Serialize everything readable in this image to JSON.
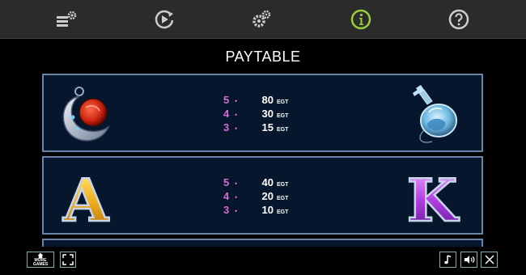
{
  "toolbar": {
    "icons": [
      "paytable-settings-icon",
      "autoplay-icon",
      "settings-icon",
      "info-icon",
      "help-icon"
    ],
    "active_color": "#9ccc3c",
    "icon_color": "#cccccc"
  },
  "title": "PAYTABLE",
  "rows": [
    {
      "left_symbol": "moon-amulet",
      "right_symbol": "potion-bottle",
      "pays": [
        {
          "count": "5",
          "value": "80",
          "unit": "EGT"
        },
        {
          "count": "4",
          "value": "30",
          "unit": "EGT"
        },
        {
          "count": "3",
          "value": "15",
          "unit": "EGT"
        }
      ]
    },
    {
      "left_symbol": "letter-a",
      "right_symbol": "letter-k",
      "left_letter": "A",
      "right_letter": "K",
      "pays": [
        {
          "count": "5",
          "value": "40",
          "unit": "EGT"
        },
        {
          "count": "4",
          "value": "20",
          "unit": "EGT"
        },
        {
          "count": "3",
          "value": "10",
          "unit": "EGT"
        }
      ]
    }
  ],
  "bottom": {
    "more_games_line1": "MORE",
    "more_games_line2": "GAMES"
  },
  "bullet": "•"
}
